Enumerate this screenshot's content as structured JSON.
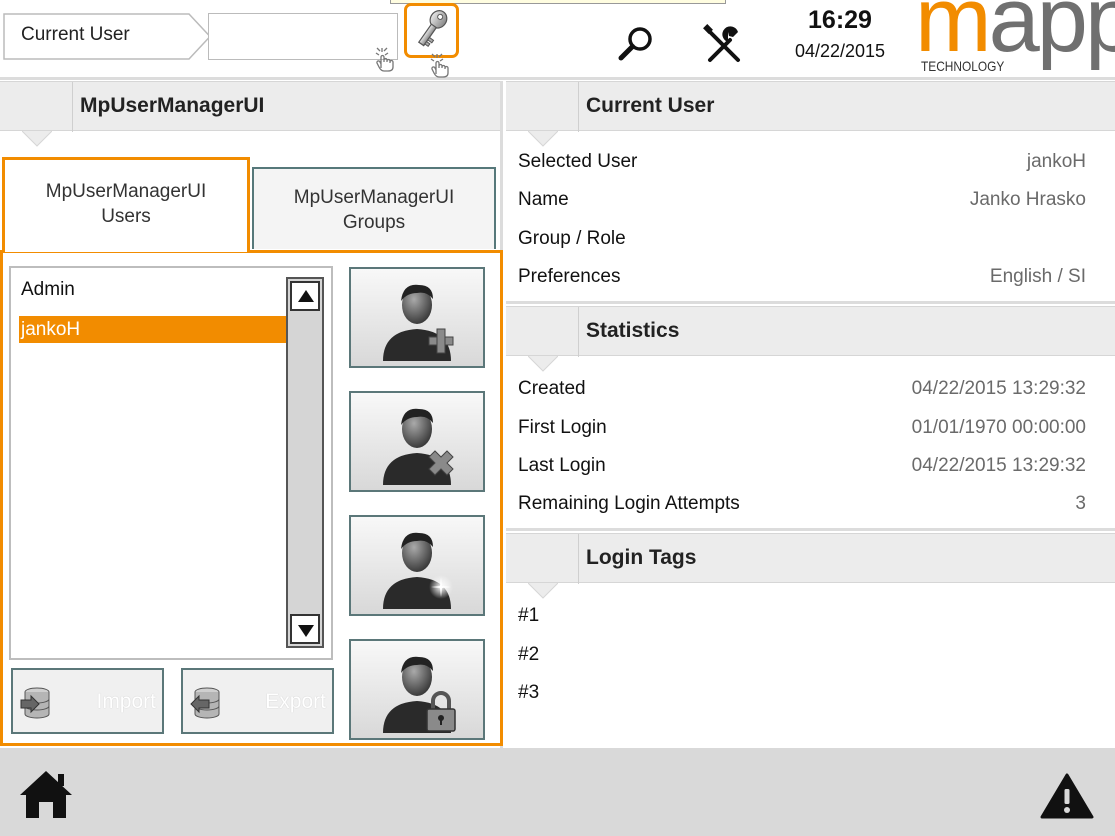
{
  "header": {
    "current_user_label": "Current User",
    "current_user_value": "",
    "time": "16:29",
    "date": "04/22/2015",
    "logo_main": "mapp",
    "logo_sub": "TECHNOLOGY",
    "icons": [
      "key-icon",
      "search-icon",
      "tools-icon",
      "hand-cursor-icon"
    ],
    "accent_color": "#f28c00"
  },
  "left_panel": {
    "title": "MpUserManagerUI",
    "tabs": [
      {
        "label": "MpUserManagerUI\nUsers",
        "active": true
      },
      {
        "label": "MpUserManagerUI\nGroups",
        "active": false
      }
    ],
    "users": [
      {
        "name": "Admin",
        "selected": false
      },
      {
        "name": "jankoH",
        "selected": true
      }
    ],
    "actions": [
      "add-user-icon",
      "delete-user-icon",
      "edit-user-icon",
      "lock-user-icon"
    ],
    "import_label": "Import",
    "export_label": "Export"
  },
  "current_user": {
    "title": "Current User",
    "rows": [
      {
        "key": "Selected User",
        "value": "jankoH"
      },
      {
        "key": "Name",
        "value": "Janko Hrasko"
      },
      {
        "key": "Group / Role",
        "value": ""
      },
      {
        "key": "Preferences",
        "value": "English / SI"
      }
    ]
  },
  "statistics": {
    "title": "Statistics",
    "rows": [
      {
        "key": "Created",
        "value": "04/22/2015 13:29:32"
      },
      {
        "key": "First Login",
        "value": "01/01/1970 00:00:00"
      },
      {
        "key": "Last Login",
        "value": "04/22/2015 13:29:32"
      },
      {
        "key": "Remaining Login Attempts",
        "value": "3"
      }
    ]
  },
  "login_tags": {
    "title": "Login Tags",
    "tags": [
      "#1",
      "#2",
      "#3"
    ]
  },
  "footer": {
    "icons": [
      "home-icon",
      "alarm-warning-icon"
    ]
  }
}
